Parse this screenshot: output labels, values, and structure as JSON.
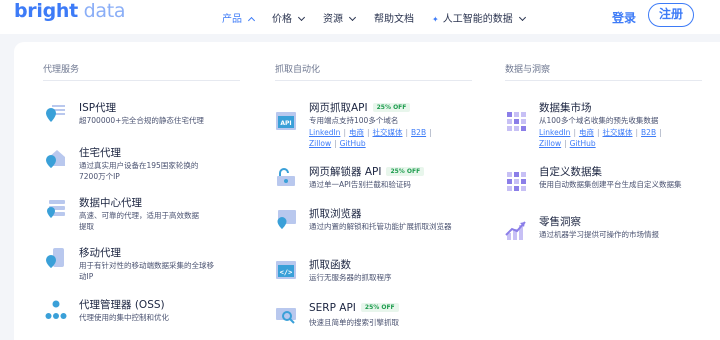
{
  "brand": {
    "logo_bold": "bright",
    "logo_light": " data",
    "accent": "#3d7bf7"
  },
  "nav": {
    "products": "产品",
    "pricing": "价格",
    "resources": "资源",
    "docs": "帮助文档",
    "ai": "人工智能的数据",
    "login": "登录",
    "signup": "注册"
  },
  "columns": [
    {
      "title": "代理服务",
      "items": [
        {
          "title": "ISP代理",
          "desc": "超700000+完全合规的静态住宅代理"
        },
        {
          "title": "住宅代理",
          "desc": "通过真实用户设备在195国家轮换的7200万个IP"
        },
        {
          "title": "数据中心代理",
          "desc": "高速、可靠的代理，适用于高效数据提取"
        },
        {
          "title": "移动代理",
          "desc": "用于有针对性的移动端数据采集的全球移动IP"
        },
        {
          "title": "代理管理器 (OSS)",
          "desc": "代理使用的集中控制和优化"
        }
      ]
    },
    {
      "title": "抓取自动化",
      "items": [
        {
          "title": "网页抓取API",
          "badge": "25% OFF",
          "desc": "专用端点支持100多个域名",
          "links": [
            "LinkedIn",
            "电商",
            "社交媒体",
            "B2B",
            "Zillow",
            "GitHub"
          ]
        },
        {
          "title": "网页解锁器 API",
          "badge": "25% OFF",
          "desc": "通过单一API告别拦截和验证码"
        },
        {
          "title": "抓取浏览器",
          "desc": "通过内置的解锁和托管功能扩展抓取浏览器"
        },
        {
          "title": "抓取函数",
          "desc": "运行无服务器的抓取程序"
        },
        {
          "title": "SERP API",
          "badge": "25% OFF",
          "desc": "快速且简单的搜索引擎抓取"
        }
      ]
    },
    {
      "title": "数据与洞察",
      "items": [
        {
          "title": "数据集市场",
          "desc": "从100多个域名收集的预先收集数据",
          "links": [
            "LinkedIn",
            "电商",
            "社交媒体",
            "B2B",
            "Zillow",
            "GitHub"
          ]
        },
        {
          "title": "自定义数据集",
          "desc": "使用自动数据集创建平台生成自定义数据集"
        },
        {
          "title": "零售洞察",
          "desc": "通过机器学习提供可操作的市场情报"
        }
      ]
    }
  ],
  "icons": {
    "isp": "pin-lines-icon",
    "residential": "house-pin-icon",
    "datacenter": "server-pin-icon",
    "mobile": "phone-pin-icon",
    "proxy_manager": "nodes-icon",
    "scraper_api": "api-window-icon",
    "unlocker": "unlock-icon",
    "browser": "browser-pin-icon",
    "functions": "code-window-icon",
    "serp": "search-window-icon",
    "datasets": "grid-icon",
    "custom_datasets": "grid-icon",
    "retail": "chart-up-icon"
  }
}
